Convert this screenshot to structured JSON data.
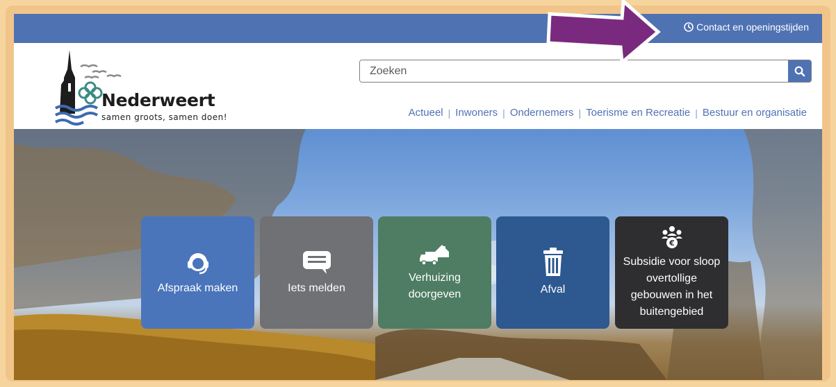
{
  "top_bar": {
    "contact_label": "Contact en openingstijden",
    "contact_icon": "clock-icon",
    "color": "#4f72b3"
  },
  "logo": {
    "name": "Nederweert",
    "slogan": "samen groots, samen doen!"
  },
  "search": {
    "placeholder": "Zoeken",
    "button_icon": "search-icon"
  },
  "nav": {
    "items": [
      {
        "label": "Actueel"
      },
      {
        "label": "Inwoners"
      },
      {
        "label": "Ondernemers"
      },
      {
        "label": "Toerisme en Recreatie"
      },
      {
        "label": "Bestuur en organisatie"
      }
    ]
  },
  "tiles": [
    {
      "label": "Afspraak maken",
      "icon": "headset-icon",
      "color": "#4a75bb"
    },
    {
      "label": "Iets melden",
      "icon": "chat-icon",
      "color": "#6f7175"
    },
    {
      "label": "Verhuizing doorgeven",
      "icon": "moving-truck-icon",
      "color": "#4e7d63"
    },
    {
      "label": "Afval",
      "icon": "trash-icon",
      "color": "#2e5890"
    },
    {
      "label": "Subsidie voor sloop overtollige gebouwen in het buitengebied",
      "icon": "subsidy-group-icon",
      "color": "#2e2e30"
    }
  ],
  "annotation": {
    "icon": "pointer-arrow-icon",
    "color": "#7a2a7e"
  },
  "frame_color": "#f1c58a"
}
